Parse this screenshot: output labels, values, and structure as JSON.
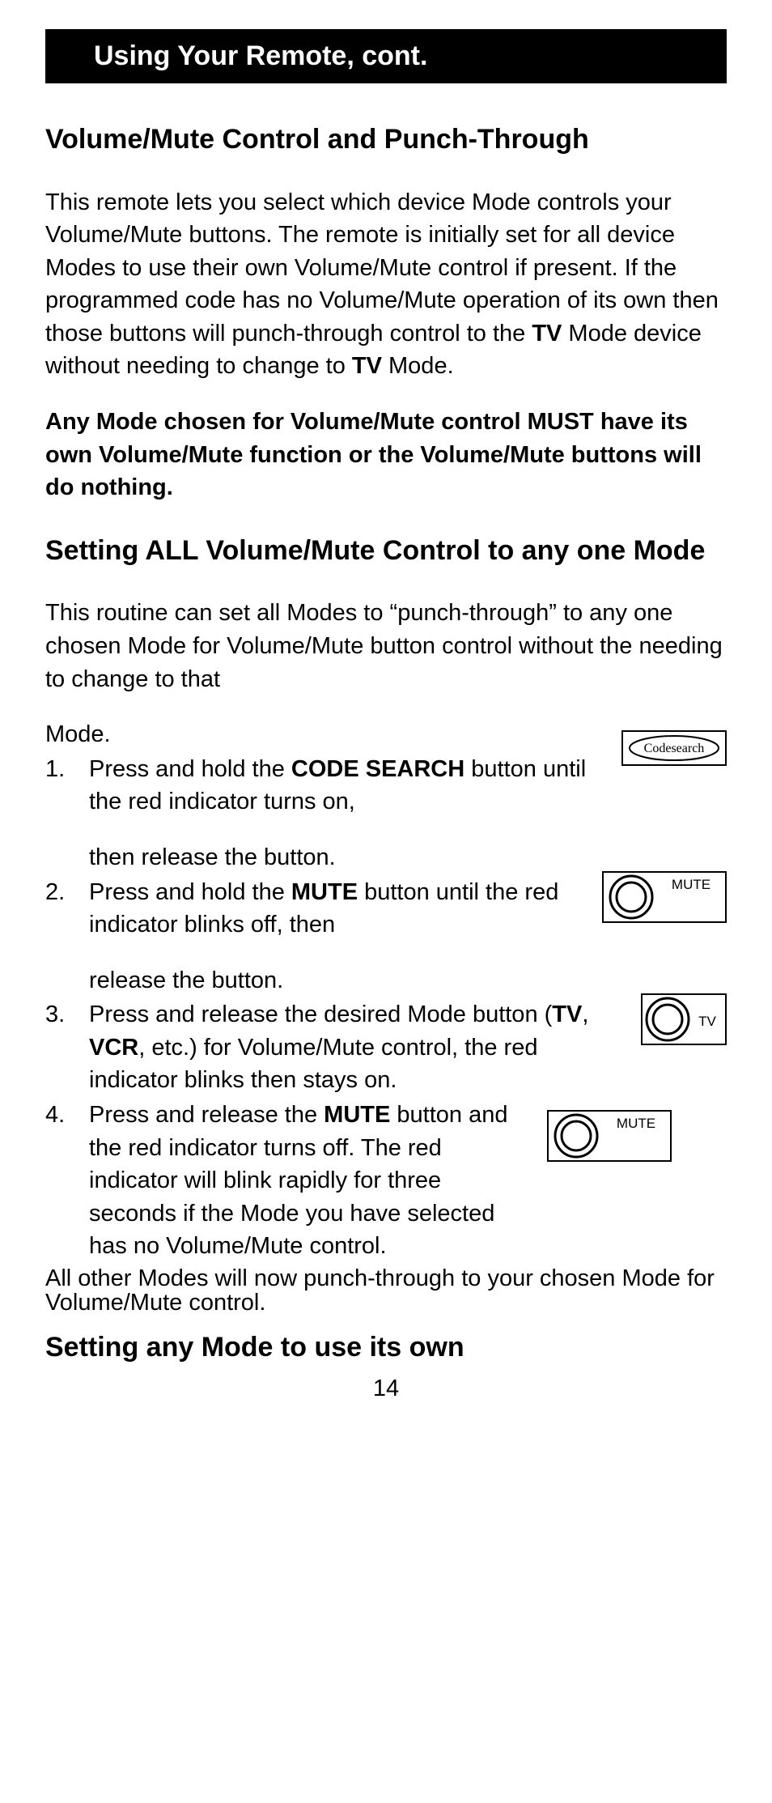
{
  "titleBar": "Using Your Remote, cont.",
  "section1": {
    "heading": "Volume/Mute Control and Punch-Through",
    "p1_a": "This remote lets you select which device Mode controls your Volume/Mute buttons. The remote is initially set for all device Modes to use their own Volume/Mute control if present. If the programmed code has no Volume/Mute operation of its own then those buttons will punch-through control to the ",
    "p1_tv1": "TV",
    "p1_b": " Mode device without needing to change to ",
    "p1_tv2": "TV",
    "p1_c": " Mode.",
    "note": "Any Mode chosen for Volume/Mute control MUST have its own Volume/Mute function or the Volume/Mute buttons will do nothing."
  },
  "section2": {
    "heading": "Setting ALL Volume/Mute Control to any one Mode",
    "intro": "This routine can set all Modes to “punch-through” to any one chosen Mode for Volume/Mute button control without the needing to change to that",
    "modeLine": "Mode.",
    "steps": {
      "s1_a": "Press and hold the ",
      "s1_cs": "CODE SEARCH",
      "s1_b": " button until the red indicator turns on,",
      "s1_c": "then release the button.",
      "s2_a": "Press and hold the ",
      "s2_mute": "MUTE",
      "s2_b": " button until the red indicator blinks off, then",
      "s2_c": "release the button.",
      "s3_a": "Press and release the desired Mode button (",
      "s3_tv": "TV",
      "s3_comma": ", ",
      "s3_vcr": "VCR",
      "s3_b": ", etc.) for Volume/Mute control, the red indicator blinks then stays on.",
      "s4_a": "Press and release the ",
      "s4_mute": "MUTE",
      "s4_b": " button and the red indicator turns off. The red indicator will blink rapidly for three seconds if the Mode you have selected has no Volume/Mute control."
    },
    "outro": "All other Modes will now punch-through to your chosen Mode for Volume/Mute control."
  },
  "section3": {
    "heading": "Setting any Mode to use its own"
  },
  "icons": {
    "codesearch": "Codesearch",
    "mute": "MUTE",
    "tv": "TV"
  },
  "pageNumber": "14"
}
